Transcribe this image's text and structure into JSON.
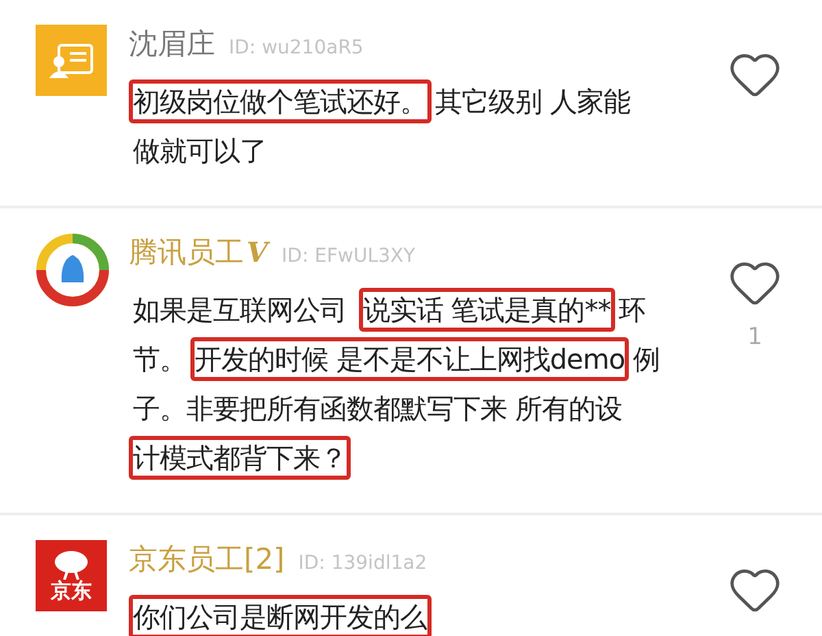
{
  "comments": [
    {
      "avatar": {
        "kind": "profile-card"
      },
      "name": "沈眉庄",
      "vip": false,
      "id": "ID: wu210aR5",
      "lines": [
        [
          {
            "text": "初级岗位做个笔试还好。",
            "highlighted": true
          },
          {
            "text": "其它级别 人家能",
            "highlighted": false
          }
        ],
        [
          {
            "text": "做就可以了",
            "highlighted": false
          }
        ]
      ]
    },
    {
      "avatar": {
        "kind": "ring"
      },
      "name": "腾讯员工",
      "badge": "V",
      "vip": true,
      "id": "ID: EFwUL3XY",
      "likes": "1",
      "lines": [
        [
          {
            "text": "如果是互联网公司 ",
            "highlighted": false
          },
          {
            "text": "说实话 笔试是真的**",
            "highlighted": true
          },
          {
            "text": "环",
            "highlighted": false
          }
        ],
        [
          {
            "text": "节。",
            "highlighted": false
          },
          {
            "text": "开发的时候 是不是不让上网找demo",
            "highlighted": true
          },
          {
            "text": "例",
            "highlighted": false
          }
        ],
        [
          {
            "text": "子。非要把所有函数都默写下来 所有的设",
            "highlighted": false
          }
        ],
        [
          {
            "text": "计模式都背下来？",
            "highlighted": true
          }
        ]
      ]
    },
    {
      "avatar": {
        "kind": "logo",
        "text": "京东"
      },
      "name": "京东员工[2]",
      "vip": true,
      "id": "ID: 139idl1a2",
      "lines": [
        [
          {
            "text": "你们公司是断网开发的么",
            "highlighted": true
          }
        ]
      ]
    }
  ]
}
